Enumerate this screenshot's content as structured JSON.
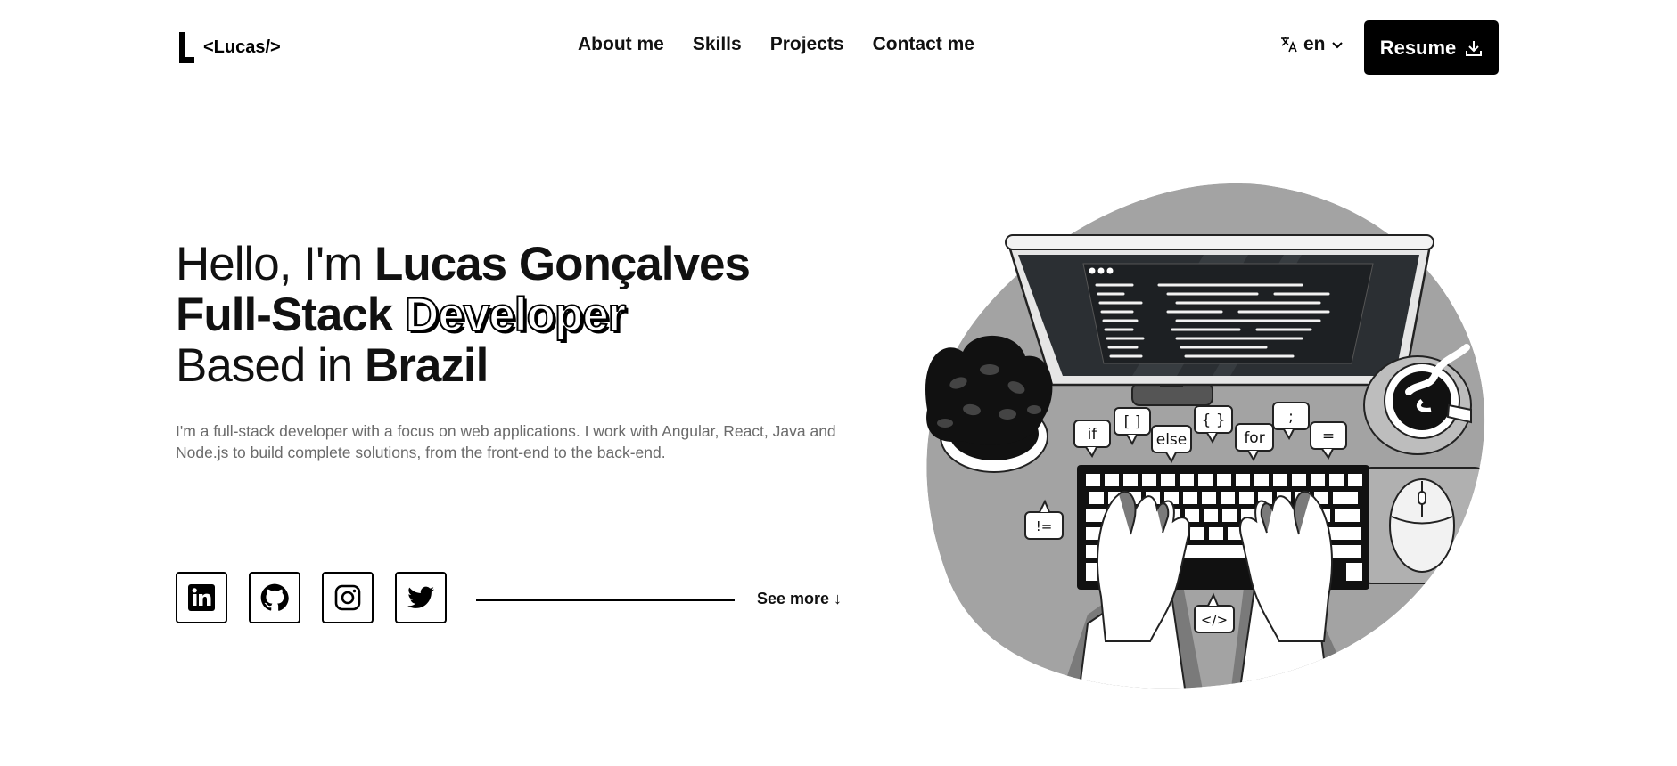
{
  "header": {
    "logo_text": "<Lucas/>",
    "nav": [
      "About me",
      "Skills",
      "Projects",
      "Contact me"
    ],
    "language": "en",
    "resume_label": "Resume"
  },
  "hero": {
    "line1_light": "Hello, I'm ",
    "line1_bold": "Lucas Gonçalves",
    "line2_bold": "Full-Stack ",
    "line2_outline": "Developer",
    "line3_light": "Based in ",
    "line3_bold": "Brazil",
    "description": "I'm a full-stack developer with a focus on web applications. I work with Angular, React, Java and Node.js to build complete solutions, from the front-end to the back-end."
  },
  "socials": {
    "icons": [
      "linkedin-icon",
      "github-icon",
      "instagram-icon",
      "twitter-icon"
    ]
  },
  "see_more": "See more ↓",
  "illustration": {
    "bubbles": [
      "if",
      "[ ]",
      "else",
      "{ }",
      "for",
      ";",
      "=",
      "!=",
      "</>"
    ]
  }
}
